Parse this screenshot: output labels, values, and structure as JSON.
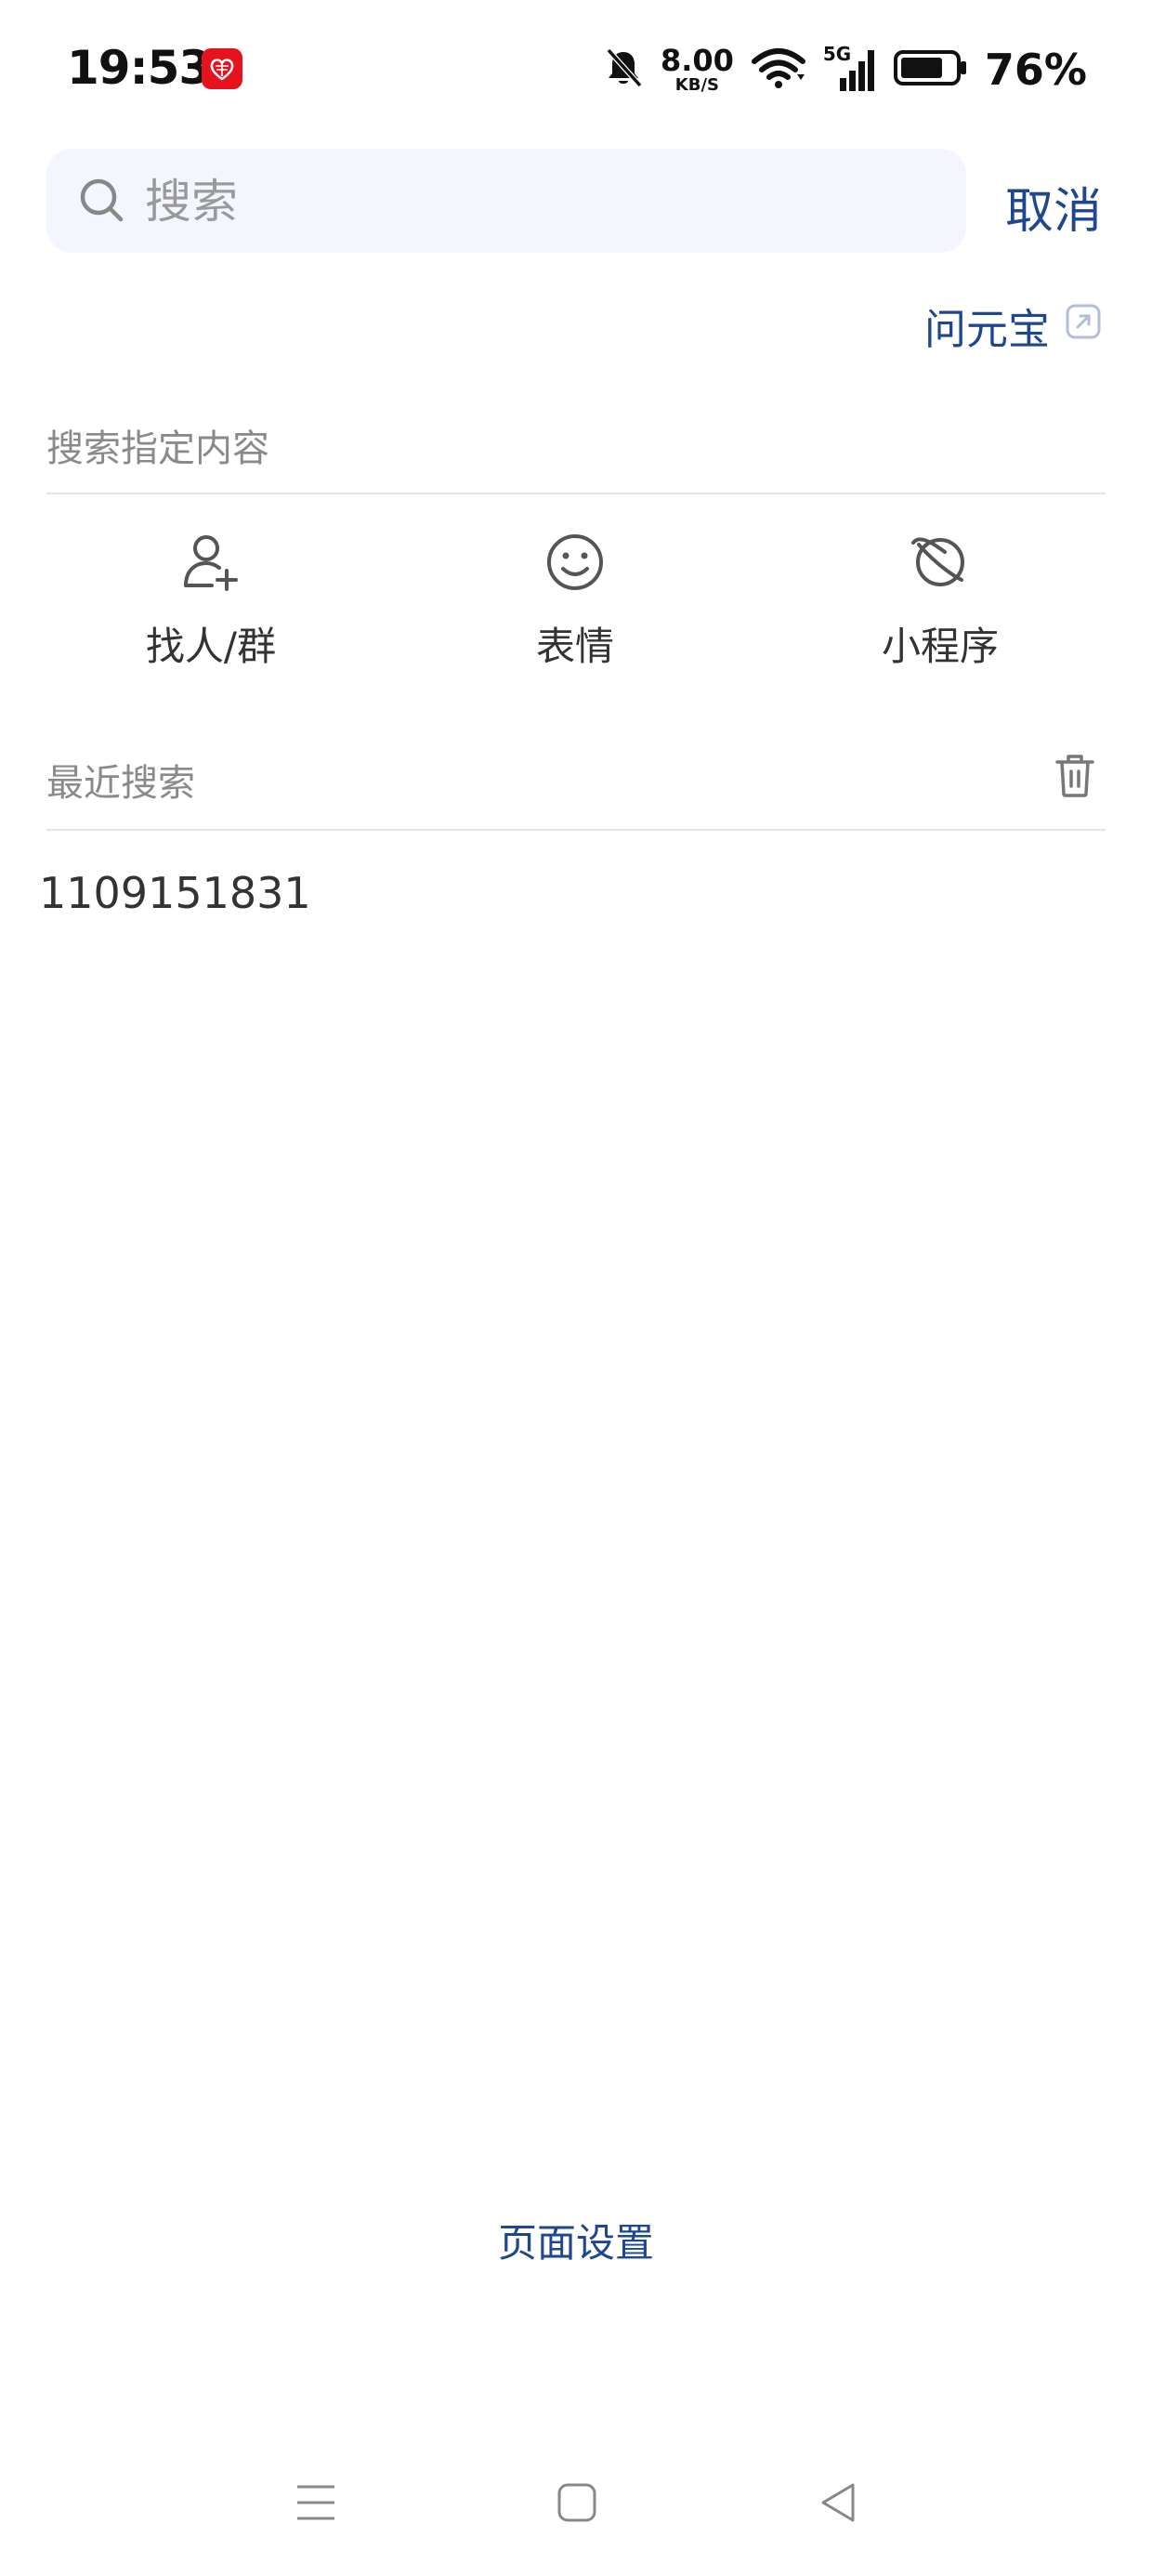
{
  "status_bar": {
    "time": "19:53",
    "net_speed_value": "8.00",
    "net_speed_unit": "KB/S",
    "signal_label": "5G",
    "battery": "76%"
  },
  "search": {
    "placeholder": "搜索",
    "value": "",
    "cancel_label": "取消"
  },
  "ai_link": {
    "label": "问元宝"
  },
  "specified": {
    "title": "搜索指定内容",
    "items": [
      {
        "label": "找人/群",
        "icon": "add-person-icon"
      },
      {
        "label": "表情",
        "icon": "smiley-icon"
      },
      {
        "label": "小程序",
        "icon": "mini-program-planet-icon"
      }
    ]
  },
  "recent": {
    "title": "最近搜索",
    "items": [
      "1109151831"
    ]
  },
  "footer": {
    "page_settings": "页面设置"
  },
  "colors": {
    "accent": "#1f4690",
    "search_bg": "#f3f6fc",
    "badge_red": "#e6121e"
  }
}
